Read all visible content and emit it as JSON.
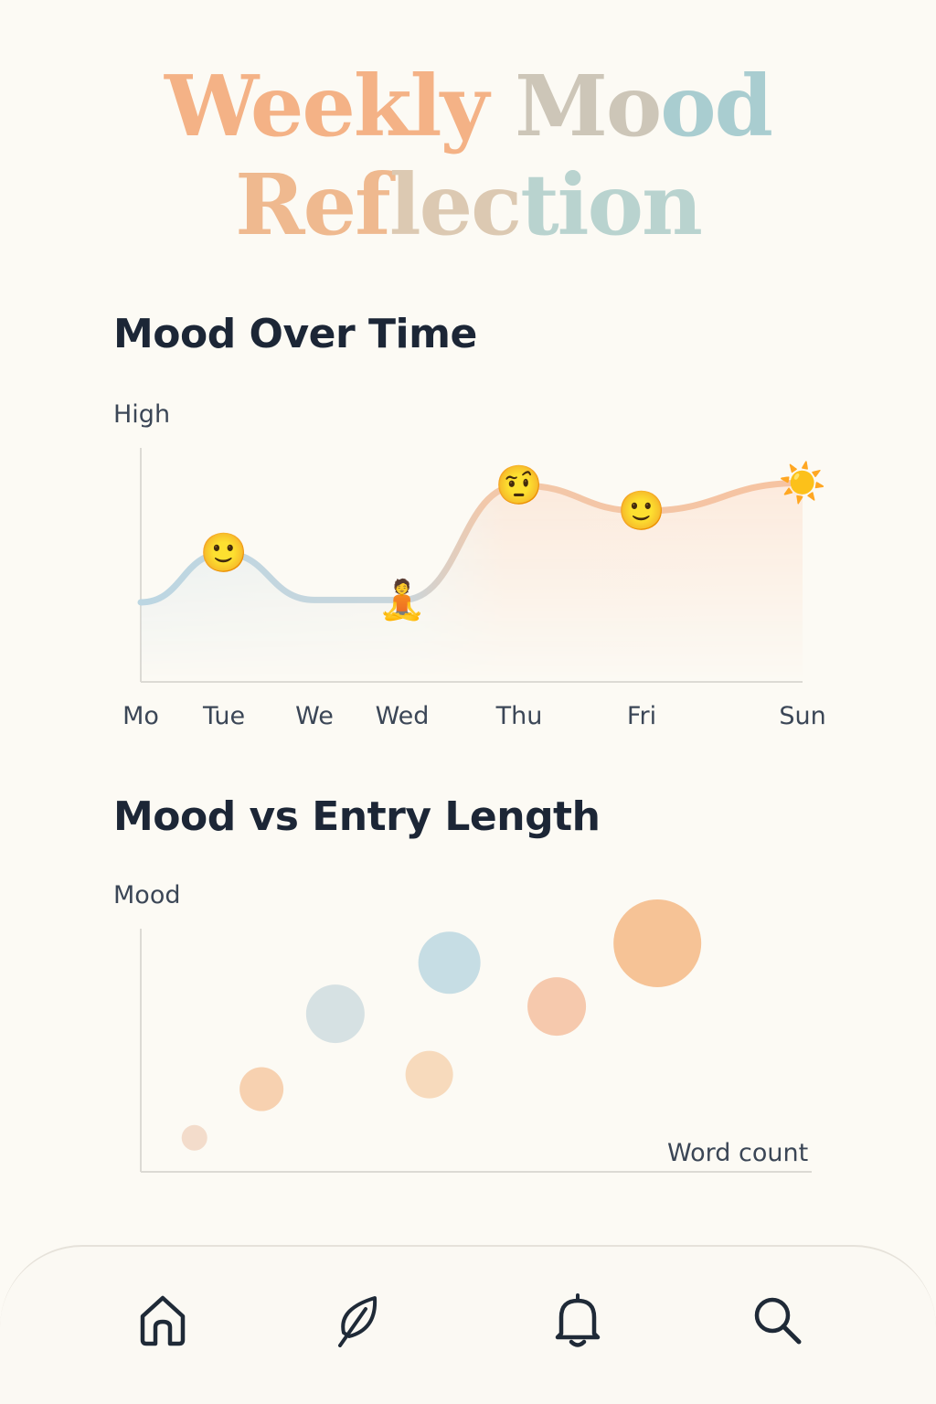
{
  "title": {
    "line1_word1": "Weekly",
    "line1_word2_a": "Mo",
    "line1_word2_b": "od",
    "line2_a": "Ref",
    "line2_b": "lec",
    "line2_c": "tion"
  },
  "mood_over_time": {
    "heading": "Mood Over Time",
    "y_label": "High",
    "days": [
      "Mo",
      "Tue",
      "We",
      "Wed",
      "Thu",
      "Fri",
      "Sun"
    ],
    "markers": [
      {
        "day": "Tue",
        "emoji": "🙂"
      },
      {
        "day": "Wed",
        "emoji": "🧘"
      },
      {
        "day": "Thu",
        "emoji": "🤨"
      },
      {
        "day": "Fri",
        "emoji": "🙂"
      },
      {
        "day": "Sun",
        "emoji": "☀️"
      }
    ]
  },
  "mood_vs_length": {
    "heading": "Mood vs Entry Length",
    "y_label": "Mood",
    "x_label": "Word count"
  },
  "nav": {
    "items": [
      {
        "name": "home",
        "icon": "home-icon"
      },
      {
        "name": "journal",
        "icon": "leaf-icon"
      },
      {
        "name": "notifications",
        "icon": "bell-icon"
      },
      {
        "name": "search",
        "icon": "search-icon"
      }
    ]
  },
  "colors": {
    "peach": "#f4b286",
    "sky": "#a9cdd8",
    "ink": "#1c2636"
  },
  "chart_data": [
    {
      "type": "area",
      "title": "Mood Over Time",
      "ylabel": "High",
      "categories": [
        "Mo",
        "Tue",
        "We",
        "Wed",
        "Thu",
        "Fri",
        "Sun"
      ],
      "values": [
        0.34,
        0.55,
        0.35,
        0.35,
        0.84,
        0.73,
        0.85
      ],
      "ylim": [
        0,
        1
      ],
      "grid": false
    },
    {
      "type": "scatter",
      "title": "Mood vs Entry Length",
      "ylabel": "Mood",
      "xlabel": "Word count",
      "xlim": [
        0,
        100
      ],
      "ylim": [
        0,
        100
      ],
      "points": [
        {
          "x": 8,
          "y": 14,
          "size": 14,
          "color": "#f1d6c3"
        },
        {
          "x": 18,
          "y": 34,
          "size": 24,
          "color": "#f6c9a3"
        },
        {
          "x": 29,
          "y": 65,
          "size": 32,
          "color": "#cfdcdf"
        },
        {
          "x": 43,
          "y": 40,
          "size": 26,
          "color": "#f6d3b2"
        },
        {
          "x": 46,
          "y": 86,
          "size": 34,
          "color": "#bcd7e1"
        },
        {
          "x": 62,
          "y": 68,
          "size": 32,
          "color": "#f5c0a0"
        },
        {
          "x": 77,
          "y": 94,
          "size": 48,
          "color": "#f5b985"
        }
      ]
    }
  ]
}
